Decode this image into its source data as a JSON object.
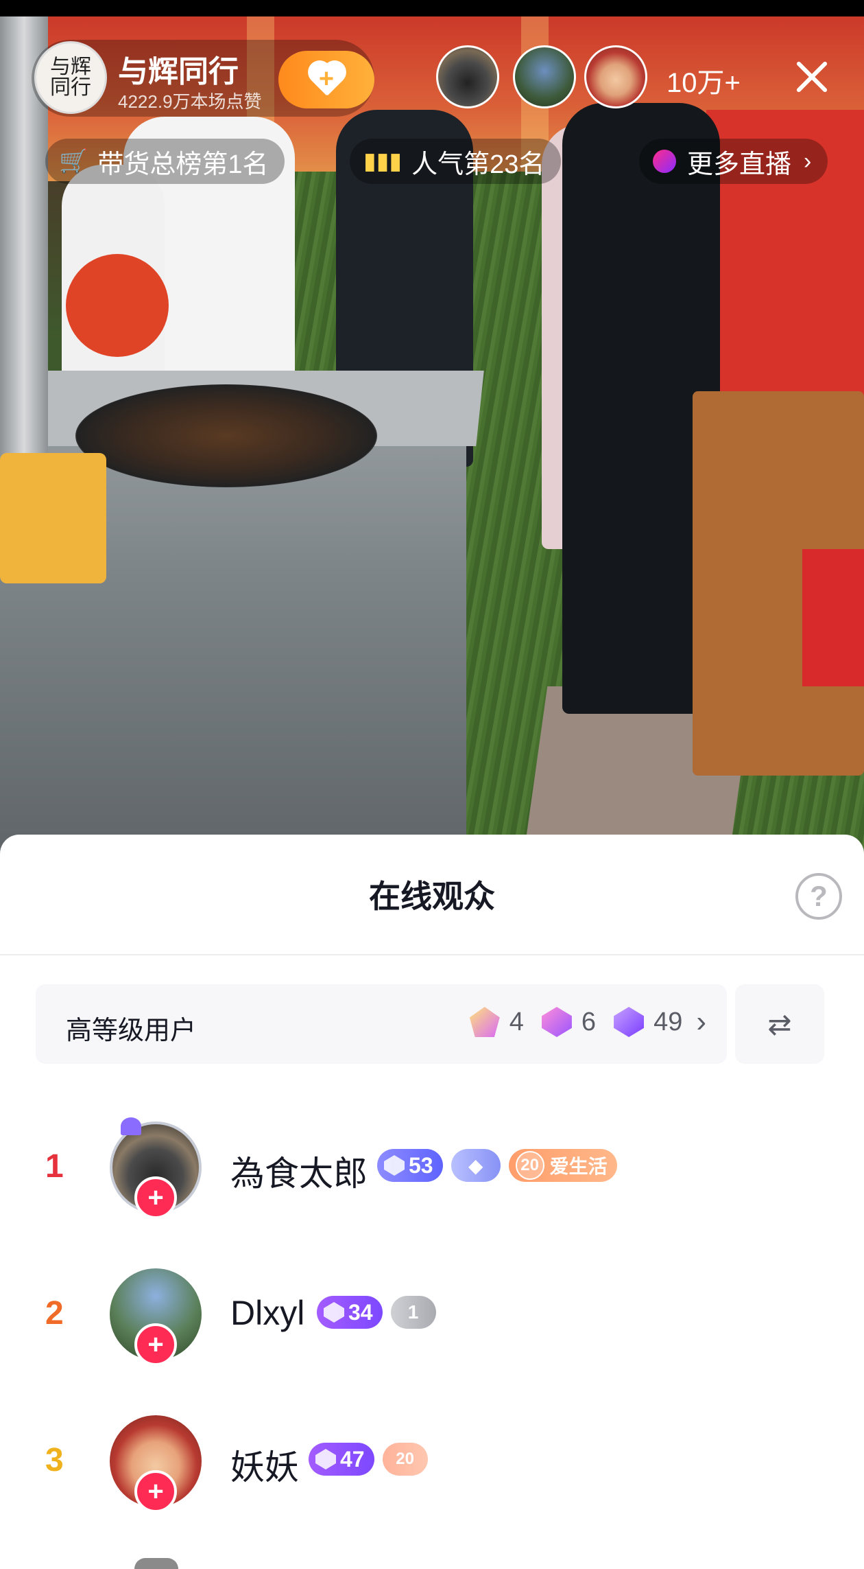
{
  "stream": {
    "host_name": "与辉同行",
    "host_avatar_text": "与辉同行",
    "likes_text": "4222.9万本场点赞",
    "viewer_count": "10万+",
    "pills": [
      {
        "icon": "cart-icon",
        "label": "带货总榜第1名"
      },
      {
        "icon": "bar-chart-icon",
        "label": "人气第23名"
      },
      {
        "icon": "live-icon",
        "label": "更多直播"
      }
    ]
  },
  "sheet": {
    "title": "在线观众",
    "help_glyph": "?",
    "level_card": {
      "label": "高等级用户",
      "counts": [
        {
          "icon": "gold-gem-icon",
          "value": "4"
        },
        {
          "icon": "violet-gem-icon",
          "value": "6"
        },
        {
          "icon": "purple-gem-icon",
          "value": "49"
        }
      ]
    },
    "audience": [
      {
        "rank": "1",
        "name": "為食太郎",
        "level": "53",
        "fan_level": "20",
        "fan_club": "爱生活"
      },
      {
        "rank": "2",
        "name": "Dlxyl",
        "level": "34",
        "fan_level": "1"
      },
      {
        "rank": "3",
        "name": "妖妖",
        "level": "47",
        "fan_level": "20"
      }
    ]
  },
  "colors": {
    "accent_red": "#fe2c55",
    "rank1": "#e6323c",
    "rank2": "#f06a28",
    "rank3": "#f0b21c",
    "follow_orange": "#ff8a1c"
  }
}
